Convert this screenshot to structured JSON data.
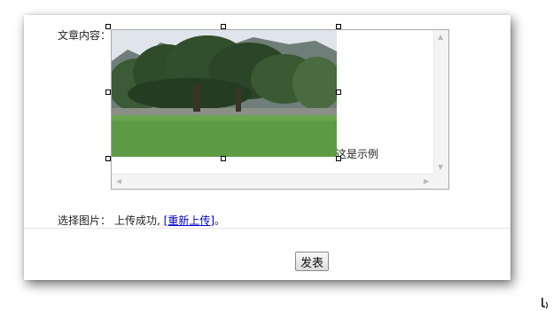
{
  "form": {
    "content_label": "文章内容：",
    "image_label": "选择图片：",
    "upload_status": "上传成功,",
    "reupload_link": "[重新上传]",
    "reupload_suffix": "。",
    "submit_label": "发表"
  },
  "editor": {
    "caption": "这是示例",
    "scroll_icons": {
      "up": "arrow-up-icon",
      "down": "arrow-down-icon",
      "left": "arrow-left-icon",
      "right": "arrow-right-icon"
    }
  },
  "colors": {
    "link": "#0000cc",
    "panel_shadow": "#000000"
  }
}
